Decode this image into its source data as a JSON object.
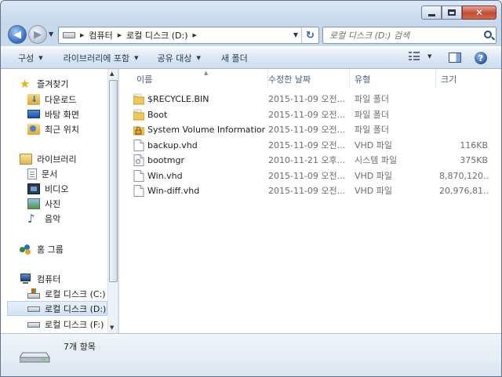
{
  "window": {
    "caption_buttons": [
      "minimize-icon",
      "maximize-icon",
      "close-icon"
    ]
  },
  "address": {
    "crumbs": [
      "컴퓨터",
      "로컬 디스크 (D:)"
    ],
    "search_placeholder": "로컬 디스크 (D:) 검색"
  },
  "toolbar": {
    "organize": "구성",
    "include_library": "라이브러리에 포함",
    "share_with": "공유 대상",
    "new_folder": "새 폴더"
  },
  "sidebar": {
    "favorites": "즐겨찾기",
    "downloads": "다운로드",
    "desktop": "바탕 화면",
    "recent": "최근 위치",
    "libraries": "라이브러리",
    "documents": "문서",
    "videos": "비디오",
    "pictures": "사진",
    "music": "음악",
    "homegroup": "홈 그룹",
    "computer": "컴퓨터",
    "drive_c": "로컬 디스크 (C:)",
    "drive_d": "로컬 디스크 (D:)",
    "drive_f": "로컬 디스크 (F:)"
  },
  "columns": {
    "name": "이름",
    "date": "수정한 날짜",
    "type": "유형",
    "size": "크기"
  },
  "files": [
    {
      "name": "$RECYCLE.BIN",
      "date": "2015-11-09 오전...",
      "type": "파일 폴더",
      "size": "",
      "icon": "folder-icon"
    },
    {
      "name": "Boot",
      "date": "2015-11-09 오전...",
      "type": "파일 폴더",
      "size": "",
      "icon": "folder-icon"
    },
    {
      "name": "System Volume Information",
      "date": "2015-11-09 오전...",
      "type": "파일 폴더",
      "size": "",
      "icon": "locked-folder-icon"
    },
    {
      "name": "backup.vhd",
      "date": "2015-11-09 오전...",
      "type": "VHD 파일",
      "size": "116KB",
      "icon": "file-icon"
    },
    {
      "name": "bootmgr",
      "date": "2010-11-21 오후...",
      "type": "시스템 파일",
      "size": "375KB",
      "icon": "system-file-icon"
    },
    {
      "name": "Win.vhd",
      "date": "2015-11-09 오전...",
      "type": "VHD 파일",
      "size": "8,870,120...",
      "icon": "file-icon"
    },
    {
      "name": "Win-diff.vhd",
      "date": "2015-11-09 오전...",
      "type": "VHD 파일",
      "size": "20,976,81...",
      "icon": "file-icon"
    }
  ],
  "status": {
    "item_count": "7개 항목"
  }
}
